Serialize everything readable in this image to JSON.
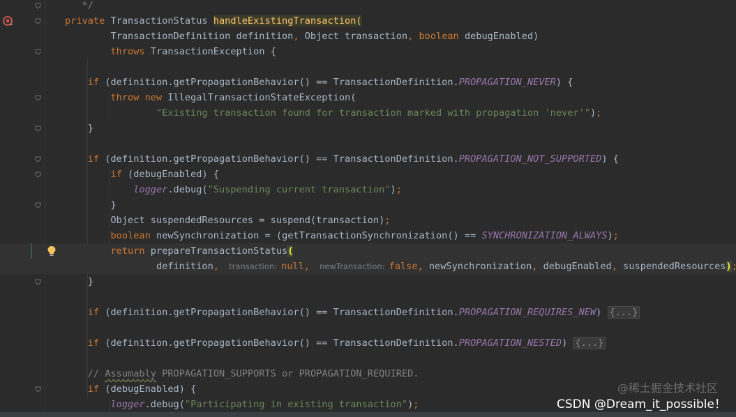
{
  "editor": {
    "lines": [
      {
        "segments": [
          {
            "t": "   */",
            "c": "cm"
          }
        ]
      },
      {
        "segments": [
          {
            "t": "private ",
            "c": "kw"
          },
          {
            "t": "TransactionStatus "
          },
          {
            "t": "handleExistingTransaction",
            "c": "hl"
          },
          {
            "t": "(",
            "c": "hl"
          }
        ]
      },
      {
        "segments": [
          {
            "t": "        TransactionDefinition definition"
          },
          {
            "t": ", ",
            "c": "kw"
          },
          {
            "t": "Object transaction"
          },
          {
            "t": ", ",
            "c": "kw"
          },
          {
            "t": "boolean ",
            "c": "kw"
          },
          {
            "t": "debugEnabled)"
          }
        ]
      },
      {
        "segments": [
          {
            "t": "        "
          },
          {
            "t": "throws ",
            "c": "kw"
          },
          {
            "t": "TransactionException {"
          }
        ]
      },
      {
        "segments": []
      },
      {
        "segments": [
          {
            "t": "    "
          },
          {
            "t": "if ",
            "c": "kw"
          },
          {
            "t": "(definition.getPropagationBehavior() == TransactionDefinition."
          },
          {
            "t": "PROPAGATION_NEVER",
            "c": "cnst"
          },
          {
            "t": ") {"
          }
        ]
      },
      {
        "segments": [
          {
            "t": "        "
          },
          {
            "t": "throw new ",
            "c": "kw"
          },
          {
            "t": "IllegalTransactionStateException("
          }
        ]
      },
      {
        "segments": [
          {
            "t": "                "
          },
          {
            "t": "\"Existing transaction found for transaction marked with propagation 'never'\"",
            "c": "str"
          },
          {
            "t": ")"
          },
          {
            "t": ";",
            "c": "kw"
          }
        ]
      },
      {
        "segments": [
          {
            "t": "    }"
          }
        ]
      },
      {
        "segments": []
      },
      {
        "segments": [
          {
            "t": "    "
          },
          {
            "t": "if ",
            "c": "kw"
          },
          {
            "t": "(definition.getPropagationBehavior() == TransactionDefinition."
          },
          {
            "t": "PROPAGATION_NOT_SUPPORTED",
            "c": "cnst"
          },
          {
            "t": ") {"
          }
        ]
      },
      {
        "segments": [
          {
            "t": "        "
          },
          {
            "t": "if ",
            "c": "kw"
          },
          {
            "t": "(debugEnabled) {"
          }
        ]
      },
      {
        "segments": [
          {
            "t": "            "
          },
          {
            "t": "logger",
            "c": "cnst"
          },
          {
            "t": ".debug("
          },
          {
            "t": "\"Suspending current transaction\"",
            "c": "str"
          },
          {
            "t": ")"
          },
          {
            "t": ";",
            "c": "kw"
          }
        ]
      },
      {
        "segments": [
          {
            "t": "        }"
          }
        ]
      },
      {
        "segments": [
          {
            "t": "        Object suspendedResources = suspend(transaction)"
          },
          {
            "t": ";",
            "c": "kw"
          }
        ]
      },
      {
        "segments": [
          {
            "t": "        "
          },
          {
            "t": "boolean ",
            "c": "kw"
          },
          {
            "t": "newSynchronization = (getTransactionSynchronization() == "
          },
          {
            "t": "SYNCHRONIZATION_ALWAYS",
            "c": "cnst"
          },
          {
            "t": ")"
          },
          {
            "t": ";",
            "c": "kw"
          }
        ]
      },
      {
        "segments": [
          {
            "t": "        "
          },
          {
            "t": "return ",
            "c": "kw"
          },
          {
            "t": "prepareTransactionStatus"
          },
          {
            "t": "(",
            "c": "brk"
          }
        ]
      },
      {
        "segments": [
          {
            "t": "                definition"
          },
          {
            "t": ", ",
            "c": "kw"
          },
          {
            "t": "transaction:",
            "c": "hint"
          },
          {
            "t": "null",
            "c": "kw"
          },
          {
            "t": ", ",
            "c": "kw"
          },
          {
            "t": "newTransaction:",
            "c": "hint"
          },
          {
            "t": "false",
            "c": "kw"
          },
          {
            "t": ", ",
            "c": "kw"
          },
          {
            "t": "newSynchronization"
          },
          {
            "t": ", ",
            "c": "kw"
          },
          {
            "t": "debugEnabled"
          },
          {
            "t": ", ",
            "c": "kw"
          },
          {
            "t": "suspendedResources"
          },
          {
            "t": ")",
            "c": "brk"
          },
          {
            "t": ";",
            "c": "kw"
          }
        ]
      },
      {
        "segments": [
          {
            "t": "    }"
          }
        ]
      },
      {
        "segments": []
      },
      {
        "segments": [
          {
            "t": "    "
          },
          {
            "t": "if ",
            "c": "kw"
          },
          {
            "t": "(definition.getPropagationBehavior() == TransactionDefinition."
          },
          {
            "t": "PROPAGATION_REQUIRES_NEW",
            "c": "cnst"
          },
          {
            "t": ") "
          },
          {
            "t": "{...}",
            "c": "fold-box"
          }
        ]
      },
      {
        "segments": []
      },
      {
        "segments": [
          {
            "t": "    "
          },
          {
            "t": "if ",
            "c": "kw"
          },
          {
            "t": "(definition.getPropagationBehavior() == TransactionDefinition."
          },
          {
            "t": "PROPAGATION_NESTED",
            "c": "cnst"
          },
          {
            "t": ") "
          },
          {
            "t": "{...}",
            "c": "fold-box"
          }
        ]
      },
      {
        "segments": []
      },
      {
        "segments": [
          {
            "t": "    "
          },
          {
            "t": "// ",
            "c": "cm"
          },
          {
            "t": "Assumably",
            "c": "cm-u"
          },
          {
            "t": " PROPAGATION_SUPPORTS or PROPAGATION_REQUIRED.",
            "c": "cm"
          }
        ]
      },
      {
        "segments": [
          {
            "t": "    "
          },
          {
            "t": "if ",
            "c": "kw"
          },
          {
            "t": "(debugEnabled) {"
          }
        ]
      },
      {
        "segments": [
          {
            "t": "        "
          },
          {
            "t": "logger",
            "c": "cnst"
          },
          {
            "t": ".debug("
          },
          {
            "t": "\"Participating in existing transaction\"",
            "c": "str"
          },
          {
            "t": ")"
          },
          {
            "t": ";",
            "c": "kw"
          }
        ]
      }
    ]
  },
  "gutter": {
    "breakpoint_icon": "method-breakpoint-icon",
    "intention_icon": "lightbulb-icon",
    "fold_icon": "fold-arrow-icon"
  },
  "watermark": {
    "text": "CSDN @Dream_it_possible！",
    "faint_text": "@稀土掘金技术社区"
  },
  "colors": {
    "background": "#2b2b2b",
    "keyword": "#cc7832",
    "string": "#6a8759",
    "constant": "#9876aa",
    "method": "#ffc66d",
    "text": "#a9b7c6",
    "comment": "#808080"
  }
}
